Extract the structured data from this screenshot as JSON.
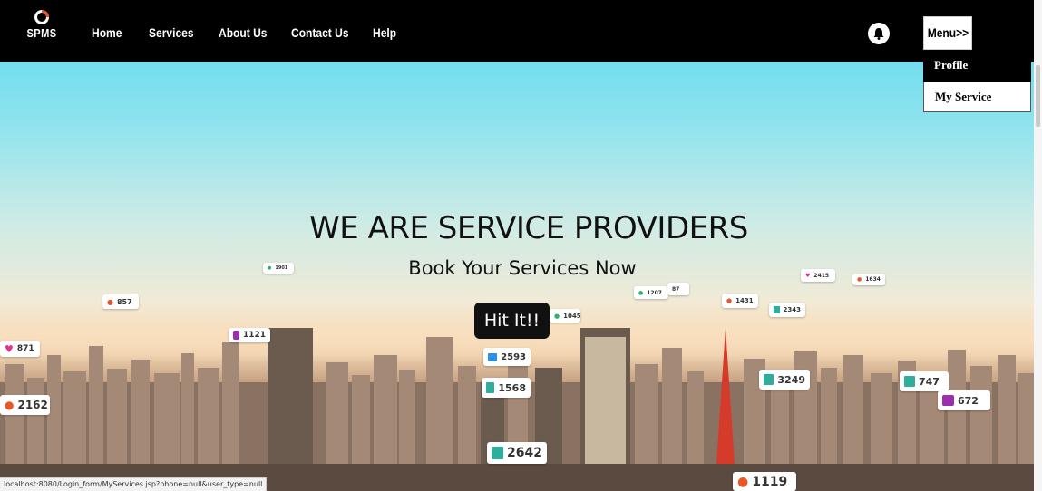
{
  "navbar": {
    "logo_text": "SPMS",
    "links": [
      "Home",
      "Services",
      "About Us",
      "Contact Us",
      "Help"
    ],
    "menu_label": "Menu>>"
  },
  "dropdown": {
    "items": [
      "Profile",
      "My Service"
    ]
  },
  "hero": {
    "headline": "WE ARE SERVICE PROVIDERS",
    "subheadline": "Book Your Services Now",
    "button_label": "Hit It!!"
  },
  "badges": [
    {
      "icon": "heart-icon",
      "color": "#e0338f",
      "value": "871"
    },
    {
      "icon": "location-pin-icon",
      "color": "#e8572a",
      "value": "2162"
    },
    {
      "icon": "location-pin-icon",
      "color": "#e8572a",
      "value": "857"
    },
    {
      "icon": "camera-icon",
      "color": "#9b2fae",
      "value": "1121"
    },
    {
      "icon": "mail-icon",
      "color": "#2f8fe0",
      "value": "2593"
    },
    {
      "icon": "thumbs-up-icon",
      "color": "#2fae9b",
      "value": "1568"
    },
    {
      "icon": "thumbs-up-icon",
      "color": "#2fae9b",
      "value": "2642"
    },
    {
      "icon": "chat-icon",
      "color": "#2fb36a",
      "value": "1045"
    },
    {
      "icon": "location-pin-icon",
      "color": "#e8572a",
      "value": "1431"
    },
    {
      "icon": "thumbs-up-icon",
      "color": "#2fae9b",
      "value": "2343"
    },
    {
      "icon": "thumbs-up-icon",
      "color": "#2fae9b",
      "value": "3249"
    },
    {
      "icon": "thumbs-up-icon",
      "color": "#2fae9b",
      "value": "747"
    },
    {
      "icon": "camera-icon",
      "color": "#9b2fae",
      "value": "672"
    },
    {
      "icon": "location-pin-icon",
      "color": "#e8572a",
      "value": "1119"
    },
    {
      "icon": "chat-icon",
      "color": "#2fb36a",
      "value": "1207"
    },
    {
      "icon": "heart-icon",
      "color": "#e0338f",
      "value": "2415"
    },
    {
      "icon": "location-pin-icon",
      "color": "#e8572a",
      "value": "1634"
    },
    {
      "icon": "user-icon",
      "color": "#2f8fe0",
      "value": "87"
    },
    {
      "icon": "chat-icon",
      "color": "#2fb36a",
      "value": "1901"
    }
  ],
  "status_bar": {
    "url": "localhost:8080/Login_form/MyServices.jsp?phone=null&user_type=null"
  },
  "colors": {
    "navbar_bg": "#000000",
    "button_bg": "#111111"
  }
}
